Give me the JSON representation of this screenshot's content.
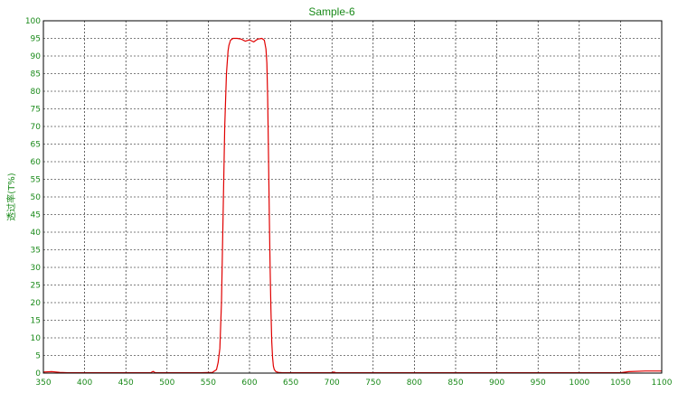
{
  "chart_data": {
    "type": "line",
    "title": "Sample-6",
    "xlabel": "",
    "ylabel": "透过率(T%)",
    "xlim": [
      350,
      1100
    ],
    "ylim": [
      0,
      100
    ],
    "x_ticks": [
      350,
      400,
      450,
      500,
      550,
      600,
      650,
      700,
      750,
      800,
      850,
      900,
      950,
      1000,
      1050,
      1100
    ],
    "y_ticks": [
      0,
      5,
      10,
      15,
      20,
      25,
      30,
      35,
      40,
      45,
      50,
      55,
      60,
      65,
      70,
      75,
      80,
      85,
      90,
      95,
      100
    ],
    "grid": true,
    "colors": {
      "line": "#e00000",
      "text": "#1a8a1a",
      "grid": "#000000"
    },
    "series": [
      {
        "x": [
          350,
          360,
          370,
          380,
          400,
          450,
          480,
          483,
          486,
          500,
          540,
          555,
          560,
          562,
          564,
          566,
          568,
          570,
          572,
          574,
          575,
          577,
          580,
          585,
          590,
          595,
          600,
          605,
          610,
          615,
          618,
          620,
          621,
          622,
          623,
          624,
          625,
          626,
          627,
          628,
          629,
          630,
          632,
          635,
          640,
          660,
          700,
          702,
          705,
          750,
          800,
          850,
          900,
          950,
          1000,
          1050,
          1060,
          1080,
          1100
        ],
        "y": [
          0.3,
          0.4,
          0.2,
          0.1,
          0.1,
          0.1,
          0.1,
          0.5,
          0.1,
          0.1,
          0.1,
          0.2,
          1.0,
          3.0,
          7.0,
          20.0,
          45.0,
          70.0,
          85.0,
          91.5,
          93.0,
          94.5,
          95.0,
          95.0,
          94.8,
          94.2,
          94.6,
          94.0,
          94.8,
          95.0,
          94.5,
          92.0,
          88.0,
          78.0,
          62.0,
          45.0,
          30.0,
          18.0,
          9.0,
          4.5,
          2.0,
          1.0,
          0.4,
          0.2,
          0.1,
          0.1,
          0.1,
          0.3,
          0.1,
          0.1,
          0.1,
          0.1,
          0.1,
          0.1,
          0.1,
          0.1,
          0.4,
          0.6,
          0.6
        ]
      }
    ]
  }
}
